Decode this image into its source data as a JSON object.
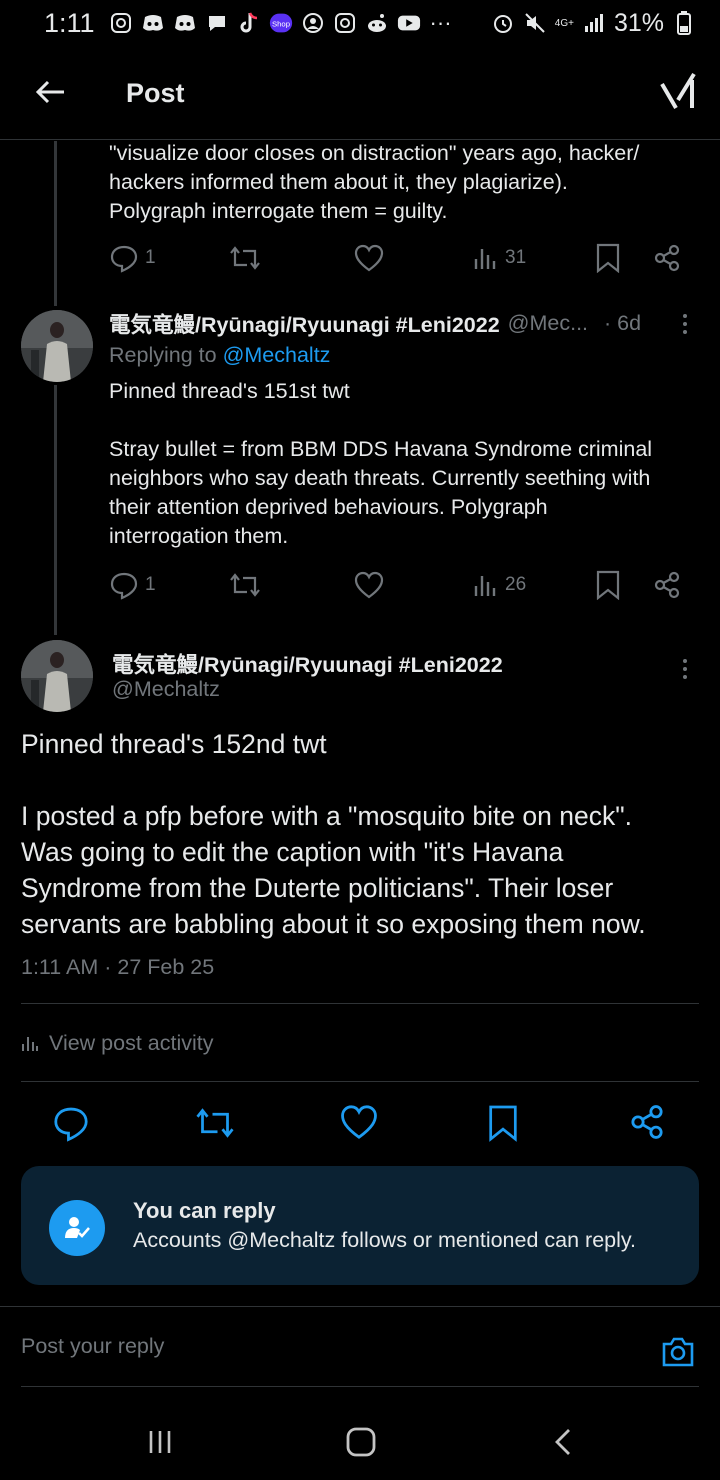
{
  "status_bar": {
    "time": "1:11",
    "network": "4G+",
    "battery": "31%",
    "notification_icons": [
      "instagram-icon",
      "discord-icon",
      "discord-icon",
      "chat-icon",
      "tiktok-icon",
      "shop-icon",
      "account-icon",
      "instagram-icon",
      "reddit-icon",
      "youtube-icon",
      "more-dots-icon"
    ]
  },
  "header": {
    "title": "Post",
    "back_icon": "arrow-left-icon",
    "grok_icon": "grok-icon"
  },
  "thread": {
    "prev_post_text": "\"visualize door closes on distraction\" years ago, hacker/\nhackers informed them about it, they plagiarize).\nPolygraph interrogate them = guilty.",
    "prev_post_stats": {
      "replies": "1",
      "views": "31"
    },
    "reply_post": {
      "name": "電気竜鰻/Ryūnagi/Ryuunagi #Leni2022",
      "handle": "@Mec...",
      "time": "· 6d",
      "replying_prefix": "Replying to",
      "replying_to": "@Mechaltz",
      "text": "Pinned thread's 151st twt\n\nStray bullet = from BBM DDS Havana Syndrome criminal\nneighbors who say death threats. Currently seething with\ntheir attention deprived behaviours. Polygraph\ninterrogation them.",
      "stats": {
        "replies": "1",
        "views": "26"
      }
    }
  },
  "main_post": {
    "name": "電気竜鰻/Ryūnagi/Ryuunagi #Leni2022",
    "handle": "@Mechaltz",
    "text": "Pinned thread's 152nd twt\n\nI posted a pfp before with a \"mosquito bite on neck\".\nWas going to edit the caption with \"it's Havana\nSyndrome from the Duterte politicians\". Their loser\nservants are babbling about it so exposing them now.",
    "timestamp": "1:11 AM · 27 Feb 25",
    "view_activity": "View post activity"
  },
  "reply_restriction": {
    "title": "You can reply",
    "description": "Accounts @Mechaltz follows or mentioned can reply."
  },
  "reply_composer": {
    "placeholder": "Post your reply"
  },
  "colors": {
    "background": "#000000",
    "text": "#e7e9ea",
    "muted": "#71767b",
    "accent": "#1d9bf0",
    "divider": "#2f3336",
    "card": "#0b2233"
  }
}
